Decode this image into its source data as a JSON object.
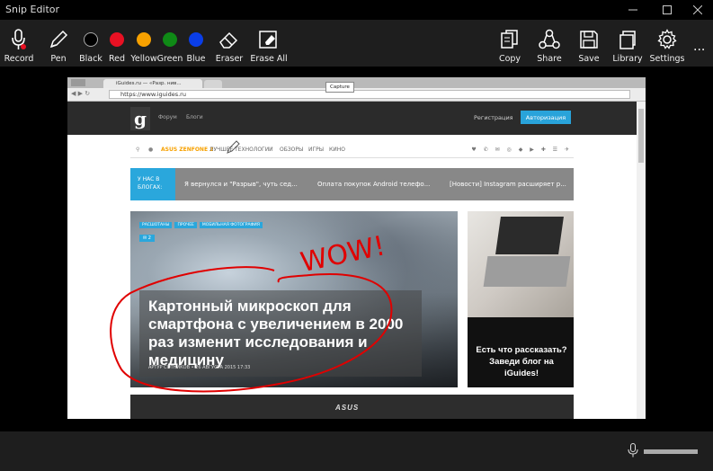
{
  "window": {
    "title": "Snip Editor",
    "controls": [
      "minimize",
      "maximize",
      "close"
    ]
  },
  "toolbar": {
    "left_tools": [
      {
        "label": "Record",
        "icon": "mic-icon"
      },
      {
        "label": "Pen",
        "icon": "pen-icon"
      },
      {
        "label": "Black",
        "color": "#000000"
      },
      {
        "label": "Red",
        "color": "#e81123"
      },
      {
        "label": "Yellow",
        "color": "#f7a100"
      },
      {
        "label": "Green",
        "color": "#0f8a16"
      },
      {
        "label": "Blue",
        "color": "#0a3ee8"
      },
      {
        "label": "Eraser",
        "icon": "eraser-icon"
      },
      {
        "label": "Erase All",
        "icon": "erase-all-icon"
      }
    ],
    "right_tools": [
      {
        "label": "Copy",
        "icon": "copy-icon"
      },
      {
        "label": "Share",
        "icon": "share-icon"
      },
      {
        "label": "Save",
        "icon": "save-icon"
      },
      {
        "label": "Library",
        "icon": "library-icon"
      },
      {
        "label": "Settings",
        "icon": "gear-icon"
      }
    ],
    "more": "..."
  },
  "capture": {
    "browser": {
      "tab_title": "iGuides.ru — «Разр. нив...",
      "url": "https://www.iguides.ru"
    },
    "tooltip": "Capture",
    "site": {
      "header_links": [
        "Форум",
        "Блоги"
      ],
      "register": "Регистрация",
      "login": "Авторизация",
      "menu": [
        "ASUS ZENFONE 2",
        "ЛУЧШЕЕ",
        "ТЕХНОЛОГИИ",
        "ОБЗОРЫ",
        "ИГРЫ",
        "КИНО"
      ],
      "blogs_label": "У НАС В БЛОГАХ:",
      "blog_items": [
        "Я вернулся и \"Разрыв\", чуть сед...",
        "Оплата покупок Android телефо...",
        "[Новости] Instagram расширяет р..."
      ],
      "tags": [
        "РАСШОТАНЫ",
        "ПРОЧЕЕ",
        "МОБИЛЬНАЯ ФОТОГРАФИЯ"
      ],
      "comments": "2",
      "headline": "Картонный микроскоп для смартфона с увеличением в 2000 раз изменит исследования и медицину",
      "byline": "АРТУР СОТНИКОВ • 26 АВГУСТА 2015 17:33",
      "ad_text": "Есть что рассказать? Заведи блог на iGuides!",
      "banner_logo": "ASUS"
    },
    "annotation_text": "WOW!",
    "annotation_color": "#e00000"
  }
}
